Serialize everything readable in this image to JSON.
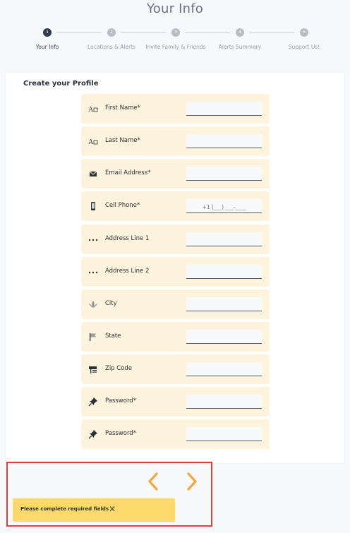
{
  "page": {
    "title": "Your Info"
  },
  "stepper": {
    "steps": [
      {
        "number": "1",
        "label": "Your Info",
        "active": true
      },
      {
        "number": "2",
        "label": "Locations & Alerts",
        "active": false
      },
      {
        "number": "3",
        "label": "Invite Family & Friends",
        "active": false
      },
      {
        "number": "4",
        "label": "Alerts Summary",
        "active": false
      },
      {
        "number": "5",
        "label": "Support Us!",
        "active": false
      }
    ]
  },
  "form": {
    "title": "Create your Profile",
    "fields": [
      {
        "icon": "font-icon",
        "label": "First Name*",
        "value": ""
      },
      {
        "icon": "font-icon",
        "label": "Last Name*",
        "value": ""
      },
      {
        "icon": "envelope-icon",
        "label": "Email Address*",
        "value": ""
      },
      {
        "icon": "phone-icon",
        "label": "Cell Phone*",
        "value": "+1 (___) ___-____"
      },
      {
        "icon": "dots-icon",
        "label": "Address Line 1",
        "value": ""
      },
      {
        "icon": "dots-icon",
        "label": "Address Line 2",
        "value": ""
      },
      {
        "icon": "lotus-icon",
        "label": "City",
        "value": ""
      },
      {
        "icon": "flag-icon",
        "label": "State",
        "value": ""
      },
      {
        "icon": "mailbox-icon",
        "label": "Zip Code",
        "value": ""
      },
      {
        "icon": "pin-icon",
        "label": "Password*",
        "value": ""
      },
      {
        "icon": "pin-icon",
        "label": "Password*",
        "value": ""
      }
    ]
  },
  "nav": {
    "prev_icon": "chevron-left-icon",
    "next_icon": "chevron-right-icon"
  },
  "toast": {
    "message": "Please complete required fields",
    "close_icon": "close-icon"
  },
  "colors": {
    "accent": "#f3a83b",
    "field_bg": "#fef3dc",
    "toast_bg": "#fcd96a",
    "highlight": "#e0403b",
    "step_active": "#2f3a4b"
  }
}
